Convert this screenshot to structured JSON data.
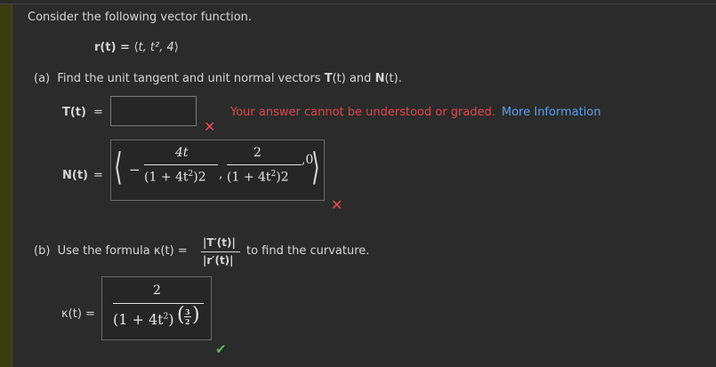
{
  "intro": "Consider the following vector function.",
  "vector": {
    "lhs": "r(t) = ",
    "content": "t, t², 4"
  },
  "part_a": {
    "label": "(a)",
    "text_prefix": "Find the unit tangent and unit normal vectors ",
    "T": "T",
    "t1": "(t)",
    "and": " and ",
    "N": "N",
    "t2": "(t).",
    "T_label": "T(t)",
    "N_label": "N(t)",
    "eq": "=",
    "T_value": "",
    "feedback": "Your answer cannot be understood or graded.",
    "more_info": "More Information",
    "N_answer": {
      "num1": "4t",
      "den1_a": "(1 + 4t",
      "den1_b": "2",
      "den1_c": ")2",
      "num2": "2",
      "den2_a": "(1 + 4t",
      "den2_b": "2",
      "den2_c": ")2",
      "third": "0"
    },
    "T_status": "incorrect",
    "N_status": "incorrect"
  },
  "part_b": {
    "label": "(b)",
    "text": "Use the formula κ(t) =",
    "num": "|T′(t)|",
    "den": "|r′(t)|",
    "suffix": "to find the curvature.",
    "k_label": "κ(t) =",
    "answer": {
      "num": "2",
      "den_a": "(1 + 4t",
      "den_b": "2",
      "den_c": ")",
      "exp_num": "3",
      "exp_den": "2"
    },
    "status": "correct"
  },
  "colors": {
    "error": "#e0474c",
    "link": "#5aa0f0",
    "correct": "#59b85c",
    "background": "#2b2b2b"
  }
}
